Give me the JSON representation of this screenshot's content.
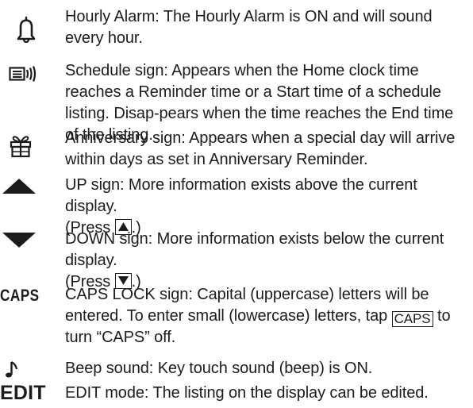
{
  "entries": [
    {
      "icon": "bell-icon",
      "title": "Hourly Alarm:",
      "description": "The Hourly Alarm is ON and will sound every hour."
    },
    {
      "icon": "schedule-sign-icon",
      "title": "Schedule sign:",
      "description": "Appears when the Home clock time reaches a Reminder time or a Start time of a schedule listing. Disap-pears when the time reaches the End time of the listing."
    },
    {
      "icon": "gift-icon",
      "title": "Anniversary sign:",
      "description": "Appears when a special day will arrive within days as set in Anniversary Reminder."
    },
    {
      "icon": "up-triangle-icon",
      "title": "UP sign:",
      "description": "More information exists above the current display.",
      "press_open": "(Press ",
      "press_key": "up-key",
      "press_close": ".)"
    },
    {
      "icon": "down-triangle-icon",
      "title": "DOWN sign:",
      "description": "More information exists below the current display.",
      "press_open": "(Press ",
      "press_key": "down-key",
      "press_close": ".)"
    },
    {
      "icon_label": "CAPS",
      "title": "CAPS LOCK sign:",
      "description_part1": "Capital (uppercase) letters will be entered. To enter small (lowercase) letters, tap",
      "key_label": "CAPS",
      "description_part2": "to turn “CAPS” off."
    },
    {
      "icon": "music-note-icon",
      "title": "Beep sound:",
      "description": "Key touch sound (beep) is ON."
    },
    {
      "icon_label": "EDIT",
      "title": "EDIT mode:",
      "description": "The listing on the display can be edited."
    }
  ]
}
